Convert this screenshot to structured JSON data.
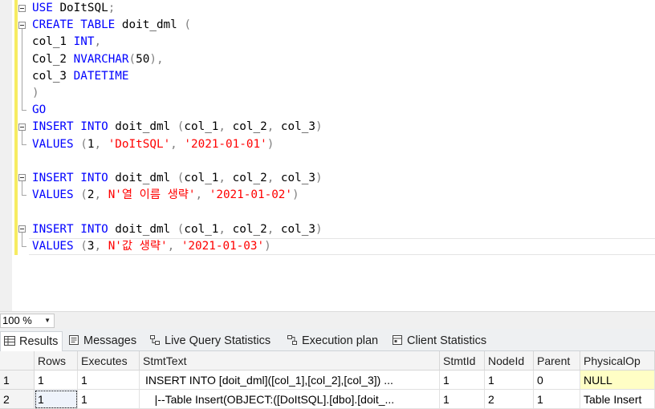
{
  "editor": {
    "lines": [
      [
        {
          "t": "USE ",
          "c": "kw"
        },
        {
          "t": "DoItSQL",
          "c": ""
        },
        {
          "t": ";",
          "c": "sym"
        }
      ],
      [
        {
          "t": "CREATE TABLE ",
          "c": "kw"
        },
        {
          "t": "doit_dml ",
          "c": ""
        },
        {
          "t": "(",
          "c": "sym"
        }
      ],
      [
        {
          "t": "col_1 ",
          "c": ""
        },
        {
          "t": "INT",
          "c": "kw"
        },
        {
          "t": ",",
          "c": "sym"
        }
      ],
      [
        {
          "t": "Col_2 ",
          "c": ""
        },
        {
          "t": "NVARCHAR",
          "c": "kw"
        },
        {
          "t": "(",
          "c": "sym"
        },
        {
          "t": "50",
          "c": ""
        },
        {
          "t": "),",
          "c": "sym"
        }
      ],
      [
        {
          "t": "col_3 ",
          "c": ""
        },
        {
          "t": "DATETIME",
          "c": "kw"
        }
      ],
      [
        {
          "t": ")",
          "c": "sym"
        }
      ],
      [
        {
          "t": "GO",
          "c": "kw"
        }
      ],
      [
        {
          "t": "INSERT INTO ",
          "c": "kw"
        },
        {
          "t": "doit_dml ",
          "c": ""
        },
        {
          "t": "(",
          "c": "sym"
        },
        {
          "t": "col_1",
          "c": ""
        },
        {
          "t": ", ",
          "c": "sym"
        },
        {
          "t": "col_2",
          "c": ""
        },
        {
          "t": ", ",
          "c": "sym"
        },
        {
          "t": "col_3",
          "c": ""
        },
        {
          "t": ")",
          "c": "sym"
        }
      ],
      [
        {
          "t": "VALUES ",
          "c": "kw"
        },
        {
          "t": "(",
          "c": "sym"
        },
        {
          "t": "1",
          "c": ""
        },
        {
          "t": ", ",
          "c": "sym"
        },
        {
          "t": "'DoItSQL'",
          "c": "str"
        },
        {
          "t": ", ",
          "c": "sym"
        },
        {
          "t": "'2021-01-01'",
          "c": "str"
        },
        {
          "t": ")",
          "c": "sym"
        }
      ],
      [],
      [
        {
          "t": "INSERT INTO ",
          "c": "kw"
        },
        {
          "t": "doit_dml ",
          "c": ""
        },
        {
          "t": "(",
          "c": "sym"
        },
        {
          "t": "col_1",
          "c": ""
        },
        {
          "t": ", ",
          "c": "sym"
        },
        {
          "t": "col_2",
          "c": ""
        },
        {
          "t": ", ",
          "c": "sym"
        },
        {
          "t": "col_3",
          "c": ""
        },
        {
          "t": ")",
          "c": "sym"
        }
      ],
      [
        {
          "t": "VALUES ",
          "c": "kw"
        },
        {
          "t": "(",
          "c": "sym"
        },
        {
          "t": "2",
          "c": ""
        },
        {
          "t": ", ",
          "c": "sym"
        },
        {
          "t": "N'열 이름 생략'",
          "c": "str"
        },
        {
          "t": ", ",
          "c": "sym"
        },
        {
          "t": "'2021-01-02'",
          "c": "str"
        },
        {
          "t": ")",
          "c": "sym"
        }
      ],
      [],
      [
        {
          "t": "INSERT INTO ",
          "c": "kw"
        },
        {
          "t": "doit_dml ",
          "c": ""
        },
        {
          "t": "(",
          "c": "sym"
        },
        {
          "t": "col_1",
          "c": ""
        },
        {
          "t": ", ",
          "c": "sym"
        },
        {
          "t": "col_2",
          "c": ""
        },
        {
          "t": ", ",
          "c": "sym"
        },
        {
          "t": "col_3",
          "c": ""
        },
        {
          "t": ")",
          "c": "sym"
        }
      ],
      [
        {
          "t": "VALUES ",
          "c": "kw"
        },
        {
          "t": "(",
          "c": "sym"
        },
        {
          "t": "3",
          "c": ""
        },
        {
          "t": ", ",
          "c": "sym"
        },
        {
          "t": "N'값 생략'",
          "c": "str"
        },
        {
          "t": ", ",
          "c": "sym"
        },
        {
          "t": "'2021-01-03'",
          "c": "str"
        },
        {
          "t": ")",
          "c": "sym"
        }
      ]
    ],
    "colors": {
      "keyword": "#0000ff",
      "string": "#ff0000",
      "symbol": "#808080",
      "change_bar": "#f6ec62"
    }
  },
  "zoom": {
    "value": "100 %",
    "arrow_icon": "dropdown-arrow-icon"
  },
  "tabs": [
    {
      "label": "Results",
      "icon": "grid-icon",
      "active": true
    },
    {
      "label": "Messages",
      "icon": "messages-icon",
      "active": false
    },
    {
      "label": "Live Query Statistics",
      "icon": "live-stats-icon",
      "active": false
    },
    {
      "label": "Execution plan",
      "icon": "execution-plan-icon",
      "active": false
    },
    {
      "label": "Client Statistics",
      "icon": "client-stats-icon",
      "active": false
    }
  ],
  "grid": {
    "columns": [
      "",
      "Rows",
      "Executes",
      "StmtText",
      "StmtId",
      "NodeId",
      "Parent",
      "PhysicalOp"
    ],
    "rows": [
      [
        "1",
        "1",
        "1",
        "INSERT INTO [doit_dml]([col_1],[col_2],[col_3]) ...",
        "1",
        "1",
        "0",
        "NULL"
      ],
      [
        "2",
        "1",
        "1",
        "   |--Table Insert(OBJECT:([DoItSQL].[dbo].[doit_...",
        "1",
        "2",
        "1",
        "Table Insert"
      ]
    ]
  }
}
